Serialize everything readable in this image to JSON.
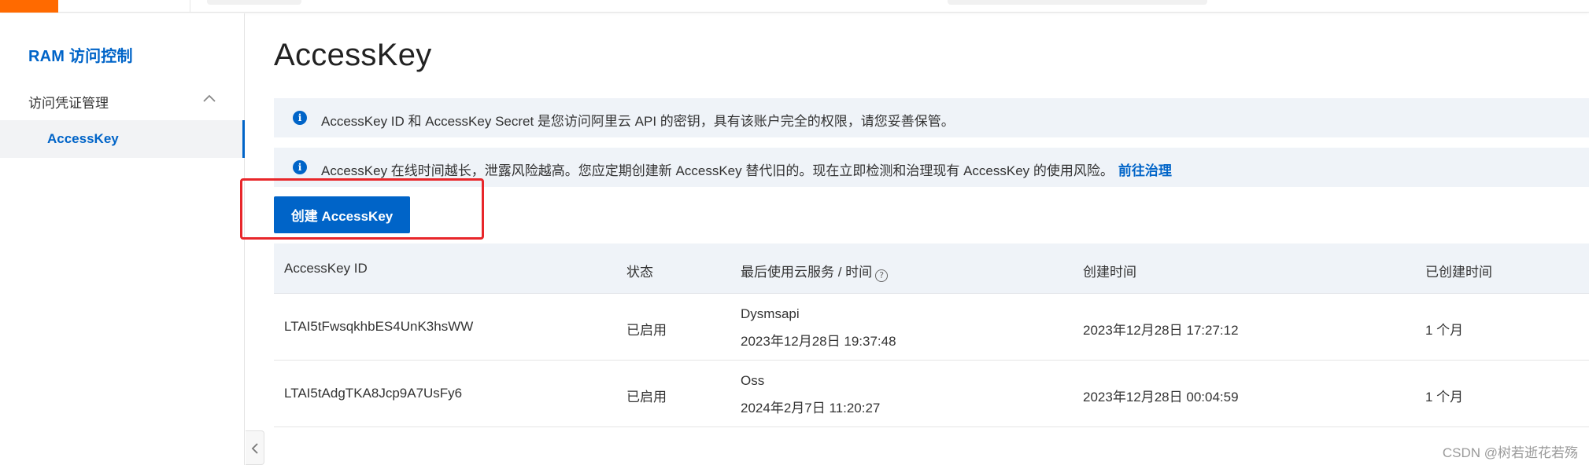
{
  "sidebar": {
    "title": "RAM 访问控制",
    "group_label": "访问凭证管理",
    "active_item": "AccessKey"
  },
  "main": {
    "title": "AccessKey",
    "notice1": "AccessKey ID 和 AccessKey Secret 是您访问阿里云 API 的密钥，具有该账户完全的权限，请您妥善保管。",
    "notice2": "AccessKey 在线时间越长，泄露风险越高。您应定期创建新 AccessKey 替代旧的。现在立即检测和治理现有 AccessKey 的使用风险。",
    "notice2_link": "前往治理",
    "create_button": "创建 AccessKey"
  },
  "table": {
    "headers": [
      "AccessKey ID",
      "状态",
      "最后使用云服务 / 时间",
      "创建时间",
      "已创建时间"
    ],
    "help_glyph": "?",
    "rows": [
      {
        "id": "LTAI5tFwsqkhbES4UnK3hsWW",
        "status": "已启用",
        "last_service": "Dysmsapi",
        "last_time": "2023年12月28日 19:37:48",
        "created": "2023年12月28日 17:27:12",
        "age": "1 个月"
      },
      {
        "id": "LTAI5tAdgTKA8Jcp9A7UsFy6",
        "status": "已启用",
        "last_service": "Oss",
        "last_time": "2024年2月7日 11:20:27",
        "created": "2023年12月28日 00:04:59",
        "age": "1 个月"
      }
    ]
  },
  "info_glyph": "i",
  "watermark": "CSDN @树若逝花若殇",
  "colors": {
    "brand_orange": "#ff6a00",
    "primary_blue": "#0064c8",
    "highlight_red": "#e8262a",
    "notice_bg": "#eff3f8"
  },
  "icons": {
    "top_logo": "aliyun-logo",
    "chevron": "chevron-up-icon",
    "info": "info-icon",
    "help": "help-circle-icon",
    "collapse": "chevron-left-icon"
  }
}
